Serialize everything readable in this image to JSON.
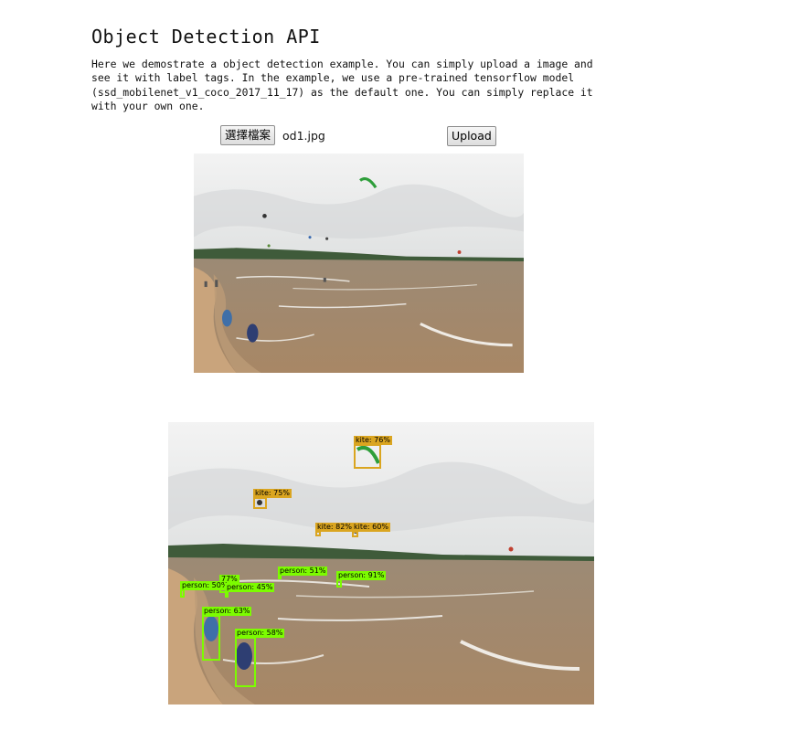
{
  "header": {
    "title": "Object Detection API",
    "description": "Here we demostrate a object detection example. You can simply upload a image and see it with label tags. In the example, we use a pre-trained tensorflow model (ssd_mobilenet_v1_coco_2017_11_17) as the default one. You can simply replace it with your own one."
  },
  "form": {
    "file_button_label": "選擇檔案",
    "file_name": "od1.jpg",
    "upload_button_label": "Upload"
  },
  "detections": [
    {
      "label": "kite: 76%",
      "class": "kite"
    },
    {
      "label": "kite: 75%",
      "class": "kite"
    },
    {
      "label": "kite: 82%",
      "class": "kite"
    },
    {
      "label": "kite: 60%",
      "class": "kite"
    },
    {
      "label": "person: 51%",
      "class": "person"
    },
    {
      "label": "person: 91%",
      "class": "person"
    },
    {
      "label": "77%",
      "class": "person"
    },
    {
      "label": "person: 50%",
      "class": "person"
    },
    {
      "label": "person: 45%",
      "class": "person"
    },
    {
      "label": "person: 63%",
      "class": "person"
    },
    {
      "label": "person: 58%",
      "class": "person"
    }
  ],
  "colors": {
    "kite_box": "#daa520",
    "person_box": "#7cfc00",
    "sky": "#eef0f0",
    "sea": "#a7896a",
    "sand": "#c9a47c"
  }
}
